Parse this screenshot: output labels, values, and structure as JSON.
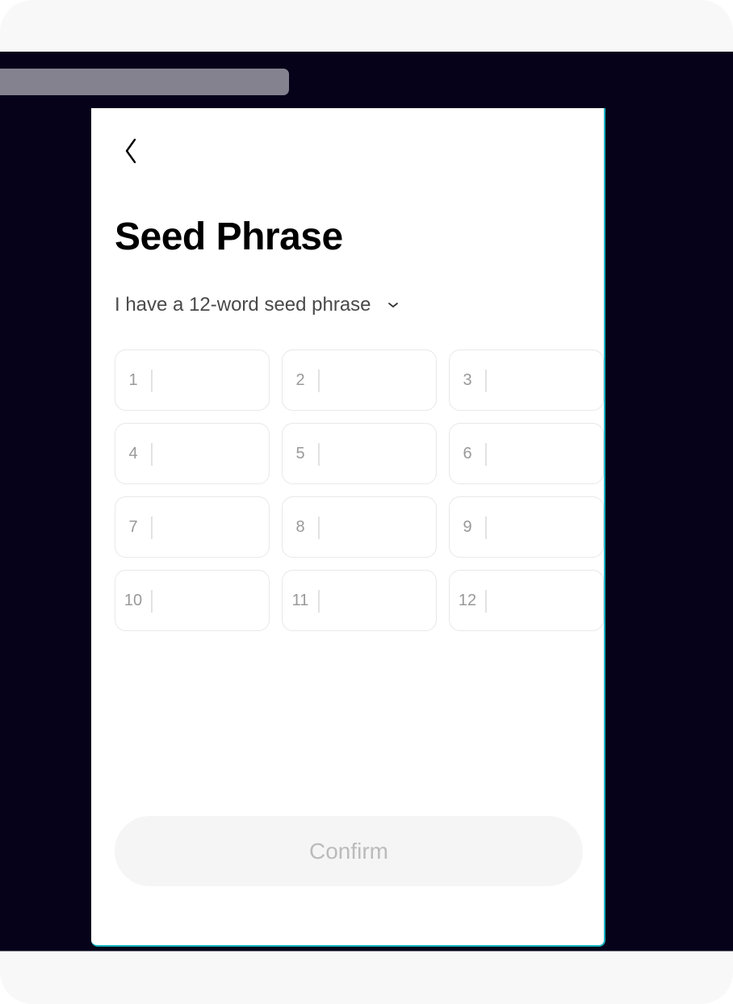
{
  "page": {
    "title": "Seed Phrase",
    "back_icon": "chevron-left-icon",
    "phrase_selector": {
      "label": "I have a 12-word seed phrase",
      "icon": "chevron-down-icon"
    },
    "word_inputs": [
      {
        "index": "1",
        "value": ""
      },
      {
        "index": "2",
        "value": ""
      },
      {
        "index": "3",
        "value": ""
      },
      {
        "index": "4",
        "value": ""
      },
      {
        "index": "5",
        "value": ""
      },
      {
        "index": "6",
        "value": ""
      },
      {
        "index": "7",
        "value": ""
      },
      {
        "index": "8",
        "value": ""
      },
      {
        "index": "9",
        "value": ""
      },
      {
        "index": "10",
        "value": ""
      },
      {
        "index": "11",
        "value": ""
      },
      {
        "index": "12",
        "value": ""
      }
    ],
    "confirm_label": "Confirm"
  },
  "colors": {
    "backdrop": "#05021a",
    "card_border": "#19b4c4",
    "button_disabled_bg": "#f5f5f5",
    "button_disabled_text": "#bbbbbb"
  }
}
